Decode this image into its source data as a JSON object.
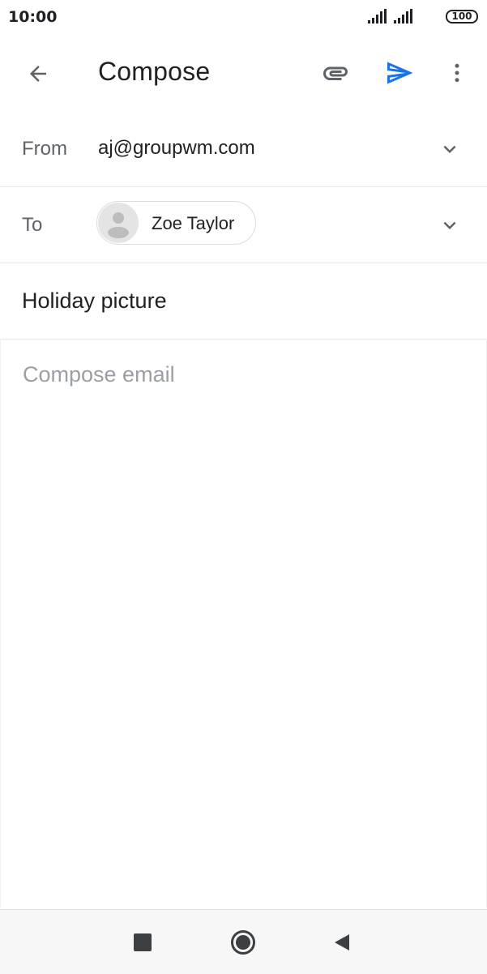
{
  "status_bar": {
    "time": "10:00",
    "battery": "100"
  },
  "app_bar": {
    "title": "Compose",
    "icons": {
      "back": "arrow-back-icon",
      "attach": "paperclip-icon",
      "send": "send-icon",
      "more": "more-vert-icon"
    },
    "send_color": "#1a73e8"
  },
  "from": {
    "label": "From",
    "value": "aj@groupwm.com"
  },
  "to": {
    "label": "To",
    "recipients": [
      {
        "name": "Zoe Taylor"
      }
    ]
  },
  "subject": {
    "value": "Holiday picture"
  },
  "body": {
    "placeholder": "Compose email"
  },
  "nav_bar": {
    "icons": [
      "recents-icon",
      "home-icon",
      "back-icon"
    ]
  }
}
